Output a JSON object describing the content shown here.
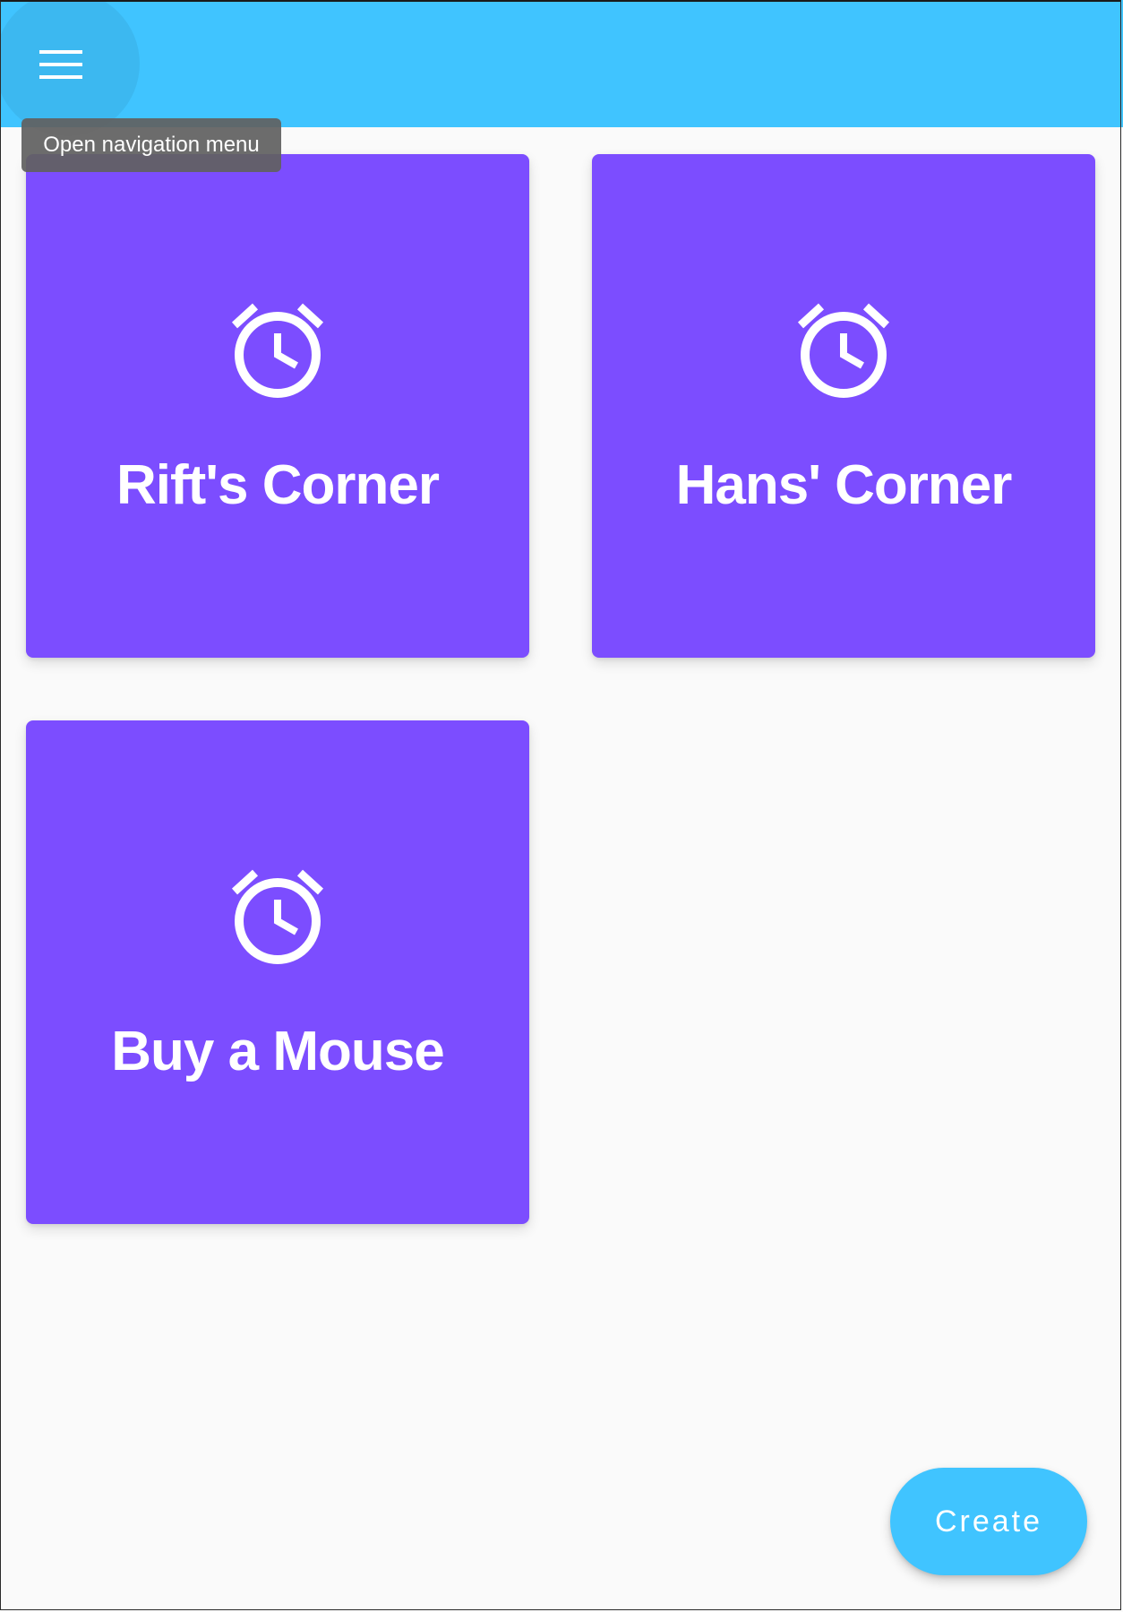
{
  "appbar": {
    "color": "#40c4ff",
    "menu_icon": "menu-icon"
  },
  "tooltip": {
    "text": "Open navigation menu"
  },
  "cards": [
    {
      "title": "Rift's Corner",
      "icon": "alarm-icon"
    },
    {
      "title": "Hans' Corner",
      "icon": "alarm-icon"
    },
    {
      "title": "Buy a Mouse",
      "icon": "alarm-icon"
    }
  ],
  "card_color": "#7c4dff",
  "fab": {
    "label": "Create",
    "color": "#40c4ff"
  }
}
